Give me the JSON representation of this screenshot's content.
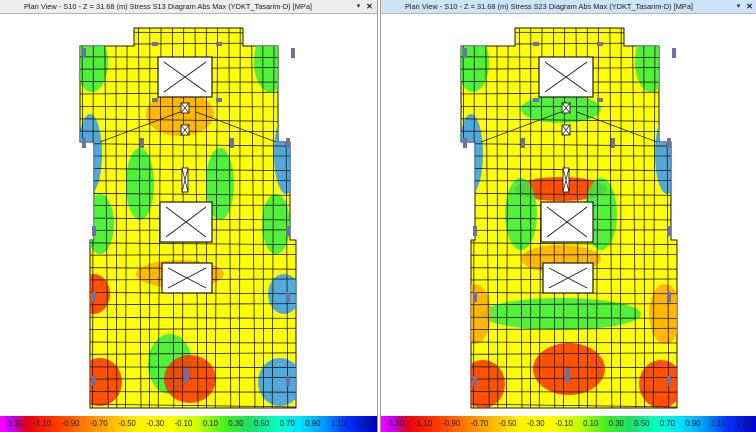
{
  "panes": [
    {
      "title": "Plan View - S10 - Z = 31.68 (m)    Stress S13 Diagram  Abs Max    (YDKT_Tasarim-D)  [MPa]",
      "active": false,
      "pin": "▾",
      "close": "✕"
    },
    {
      "title": "Plan View - S10 - Z = 31.68 (m)    Stress S23 Diagram  Abs Max    (YDKT_Tasarim-D)  [MPa]",
      "active": true,
      "pin": "▾",
      "close": "✕"
    }
  ],
  "legend": {
    "labels": [
      "-1.30",
      "-1.10",
      "-0.90",
      "-0.70",
      "-0.50",
      "-0.30",
      "-0.10",
      "0.10",
      "0.30",
      "0.50",
      "0.70",
      "0.90",
      "1.10",
      "1.30"
    ]
  },
  "colors": {
    "slab_base": "#ffff00",
    "mesh_line": "#1a1a1a",
    "support": "#7070a0",
    "hot": "#ff3300",
    "mild": "#ffaa00",
    "cool": "#33ee44",
    "cold": "#3399ff"
  }
}
